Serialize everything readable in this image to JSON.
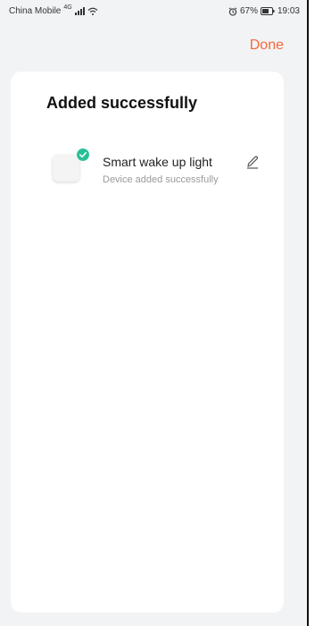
{
  "status_bar": {
    "carrier": "China Mobile",
    "network": "4G",
    "battery": "67%",
    "time": "19:03",
    "icons": [
      "signal-icon",
      "wifi-icon",
      "alarm-icon",
      "battery-icon"
    ]
  },
  "header": {
    "done_label": "Done"
  },
  "card": {
    "title": "Added successfully",
    "device": {
      "name": "Smart wake up light",
      "status": "Device added successfully",
      "icons": [
        "device-icon",
        "success-check-icon",
        "edit-icon"
      ]
    }
  },
  "colors": {
    "accent": "#f36a3a",
    "success": "#27c195",
    "background": "#f2f3f5",
    "card": "#ffffff"
  }
}
